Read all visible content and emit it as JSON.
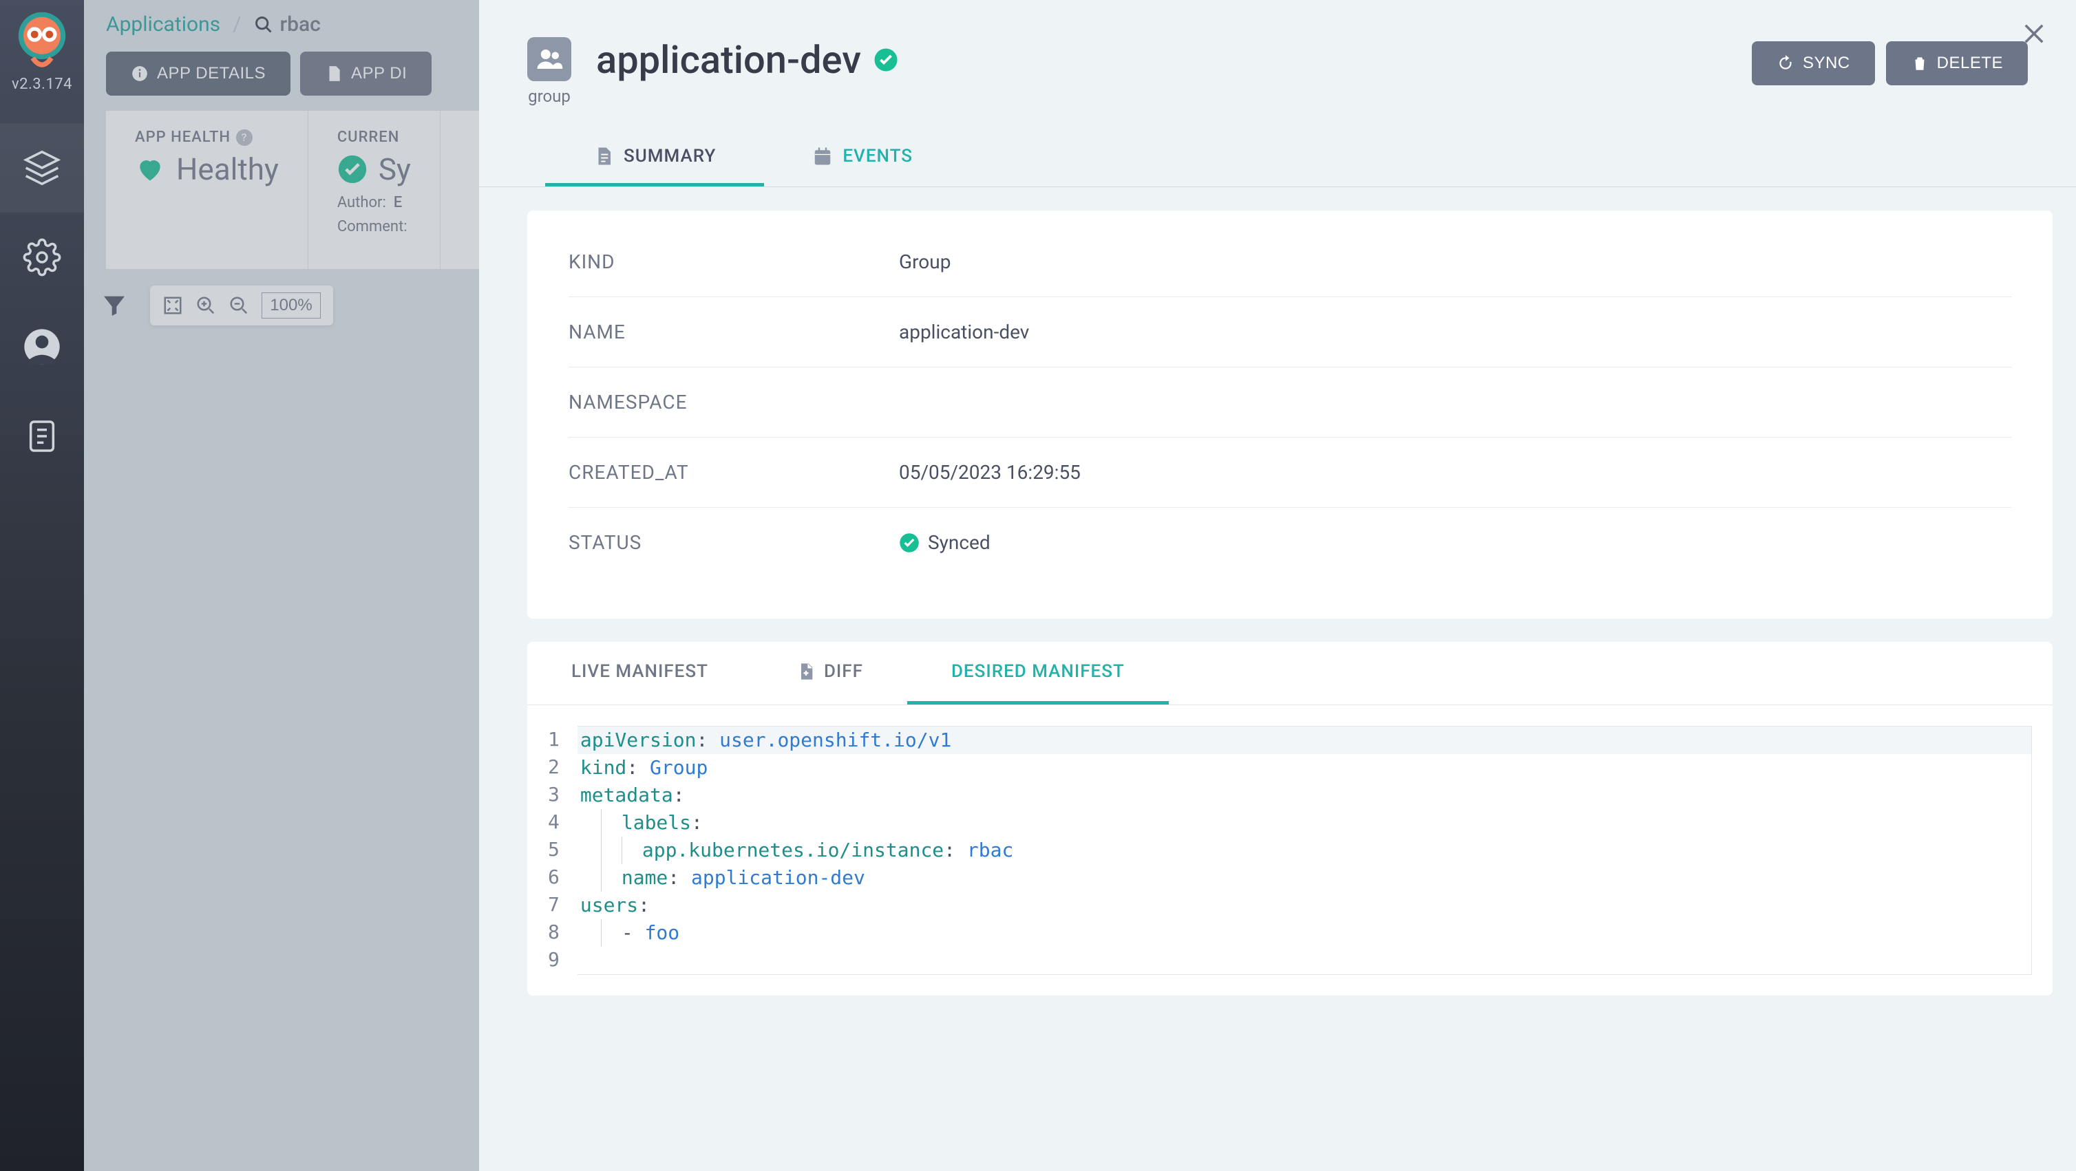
{
  "version": "v2.3.174",
  "breadcrumb": {
    "root": "Applications",
    "current": "rbac"
  },
  "toolbar": {
    "app_details": "APP DETAILS",
    "app_diff": "APP DI"
  },
  "health": {
    "label": "APP HEALTH",
    "value": "Healthy"
  },
  "sync": {
    "label": "CURREN",
    "value": "Sy",
    "author_label": "Author:",
    "author_value": "E",
    "comment_label": "Comment:"
  },
  "zoom": "100%",
  "panel": {
    "resource_type": "group",
    "title": "application-dev",
    "btn_sync": "SYNC",
    "btn_delete": "DELETE",
    "tabs": {
      "summary": "SUMMARY",
      "events": "EVENTS"
    },
    "summary": {
      "kind_k": "KIND",
      "kind_v": "Group",
      "name_k": "NAME",
      "name_v": "application-dev",
      "ns_k": "NAMESPACE",
      "ns_v": "",
      "created_k": "CREATED_AT",
      "created_v": "05/05/2023 16:29:55",
      "status_k": "STATUS",
      "status_v": "Synced"
    },
    "manifest_tabs": {
      "live": "LIVE MANIFEST",
      "diff": "DIFF",
      "desired": "DESIRED MANIFEST"
    },
    "manifest": {
      "l1k": "apiVersion",
      "l1v": "user.openshift.io/v1",
      "l2k": "kind",
      "l2v": "Group",
      "l3k": "metadata",
      "l4k": "labels",
      "l5k": "app.kubernetes.io/instance",
      "l5v": "rbac",
      "l6k": "name",
      "l6v": "application-dev",
      "l7k": "users",
      "l8v": "foo"
    }
  }
}
